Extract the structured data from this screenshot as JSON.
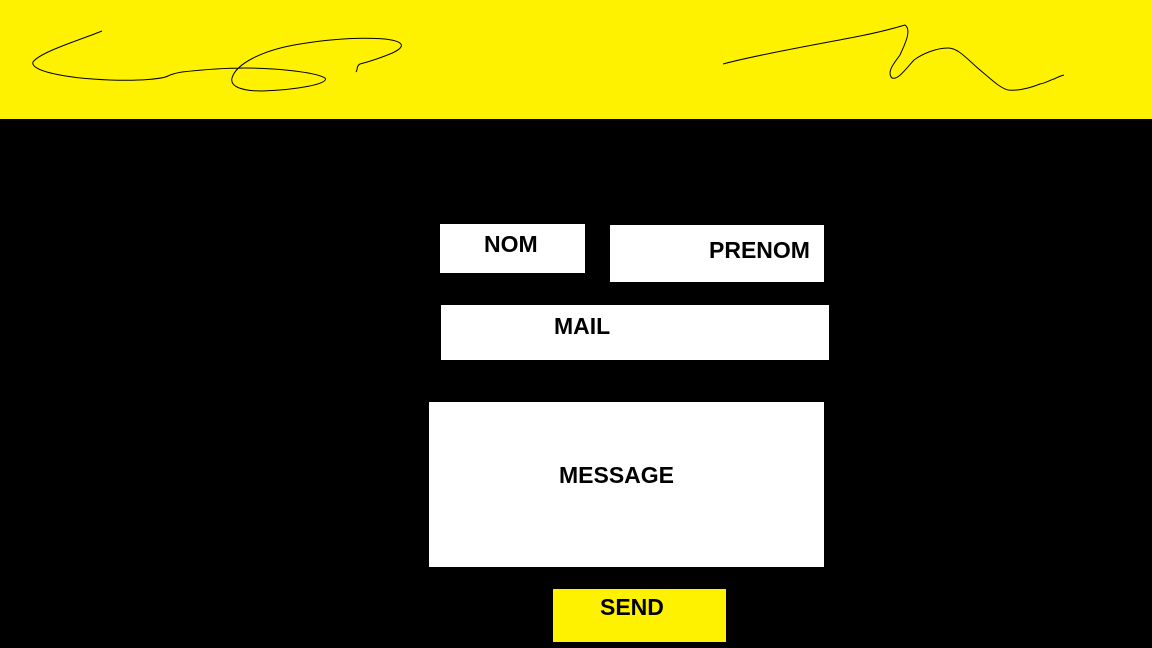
{
  "colors": {
    "background": "#000000",
    "accent": "#fff200",
    "field": "#ffffff",
    "text": "#000000"
  },
  "header": {
    "signature_image": "handwritten-signature"
  },
  "form": {
    "nom_label": "NOM",
    "prenom_label": "PRENOM",
    "mail_label": "MAIL",
    "message_label": "MESSAGE",
    "send_label": "SEND"
  }
}
